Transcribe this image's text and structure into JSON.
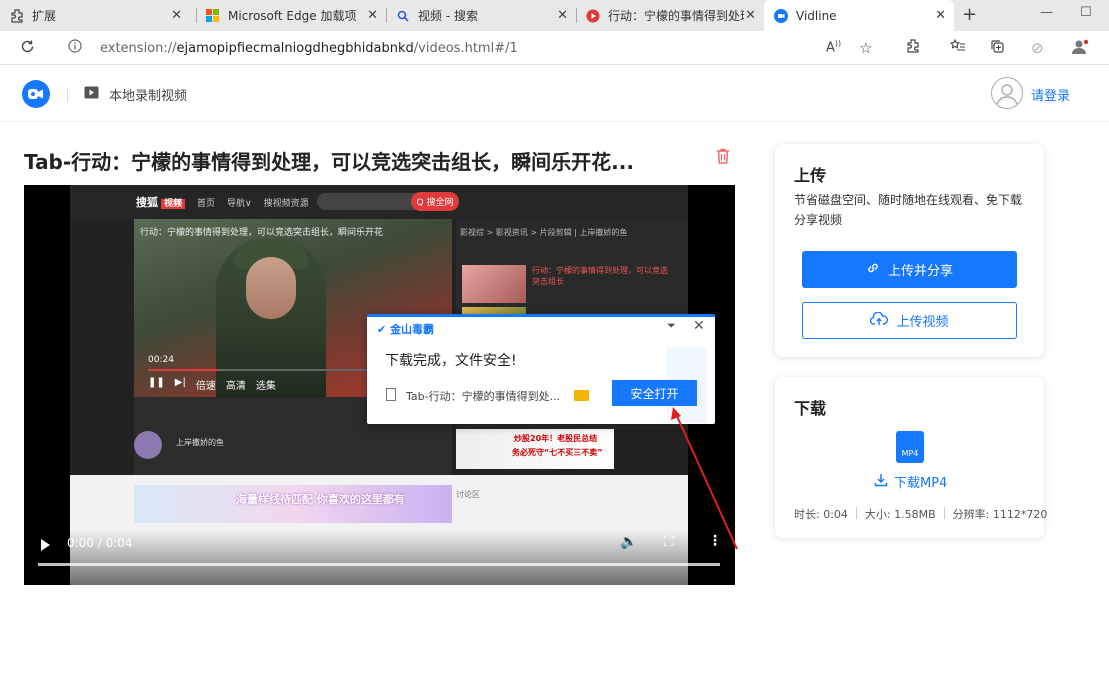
{
  "browser": {
    "tabs": [
      {
        "title": "扩展"
      },
      {
        "title": "Microsoft Edge 加载项 - 影"
      },
      {
        "title": "视频 - 搜索"
      },
      {
        "title": "行动：宁檬的事情得到处理"
      },
      {
        "title": "Vidline"
      }
    ],
    "url_scheme": "extension://",
    "url_host": "ejamopipfiecmalniogdhegbhidabnkd",
    "url_path": "/videos.html#/1"
  },
  "header": {
    "nav_label": "本地录制视频",
    "login_label": "请登录"
  },
  "video": {
    "title": "Tab-行动：宁檬的事情得到处理，可以竞选突击组长，瞬间乐开花...",
    "time": "0:00 / 0:04",
    "progress": 0,
    "page_brand": "搜狐",
    "page_brand_tag": "视频",
    "page_nav": [
      "首页",
      "导航∨",
      "搜视频资源"
    ],
    "search_btn": "Q 搜全网",
    "frame_caption": "行动：宁檬的事情得到处理，可以竞选突击组长，瞬间乐开花",
    "player_time": "00:24",
    "player_ctrls": [
      "倍速",
      "高清",
      "选集"
    ],
    "sidebar_crumb": "影视综 > 影视资讯 > 片段剪辑 | 上岸撒娇的鱼",
    "sidebar_item": "行动：宁檬的事情得到处理，可以竞选突击组长",
    "uploader": "上岸撒娇的鱼",
    "ad_headline": "炒股20年！老股民总结",
    "ad_sub": "务必死守“七不买三不卖”",
    "banner_text": "海量样线待匹配 你喜欢的这里都有",
    "comment_label": "讨论区"
  },
  "popup": {
    "brand": "金山毒霸",
    "message": "下载完成，文件安全!",
    "file_name": "Tab-行动：宁檬的事情得到处...",
    "open_button": "安全打开"
  },
  "upload_card": {
    "title": "上传",
    "desc": "节省磁盘空间、随时随地在线观看、免下载分享视频",
    "share_button": "上传并分享",
    "upload_button": "上传视频"
  },
  "download_card": {
    "title": "下载",
    "file_type": "MP4",
    "download_link": "下载MP4",
    "duration": "时长: 0:04",
    "size": "大小: 1.58MB",
    "resolution": "分辨率: 1112*720"
  },
  "colors": {
    "accent": "#1677ff",
    "danger": "#e03a3a",
    "arrow": "#e02020"
  }
}
